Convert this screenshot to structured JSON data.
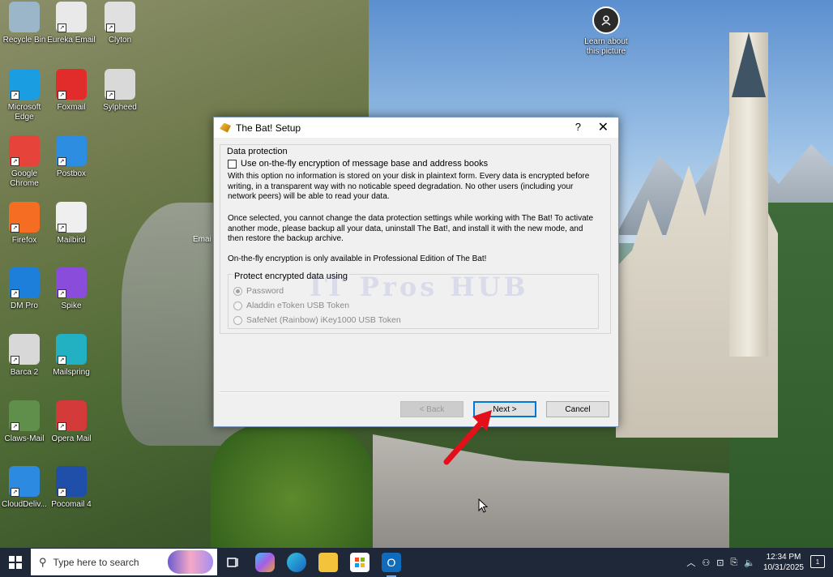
{
  "desktop": {
    "icons": [
      {
        "label": "Recycle Bin",
        "icon": "recycle-bin-icon",
        "color": "#9bb6c9"
      },
      {
        "label": "Eureka Email",
        "icon": "eureka-email-icon",
        "color": "#e9e9e9"
      },
      {
        "label": "Clyton",
        "icon": "clyton-icon",
        "color": "#e0e0e0"
      },
      {
        "label": "Microsoft Edge",
        "icon": "edge-icon",
        "color": "#1b9de2"
      },
      {
        "label": "Foxmail",
        "icon": "foxmail-icon",
        "color": "#e22b2b"
      },
      {
        "label": "Sylpheed",
        "icon": "sylpheed-icon",
        "color": "#d9d9d9"
      },
      {
        "label": "Google Chrome",
        "icon": "chrome-icon",
        "color": "#e6433a"
      },
      {
        "label": "Postbox",
        "icon": "postbox-icon",
        "color": "#2d8de0"
      },
      {
        "label": "Firefox",
        "icon": "firefox-icon",
        "color": "#f46d22"
      },
      {
        "label": "Mailbird",
        "icon": "mailbird-icon",
        "color": "#efefef"
      },
      {
        "label": "DM Pro",
        "icon": "dm-pro-icon",
        "color": "#1d7fd9"
      },
      {
        "label": "Spike",
        "icon": "spike-icon",
        "color": "#8a4ddb"
      },
      {
        "label": "Barca 2",
        "icon": "barca-icon",
        "color": "#d8d8d8"
      },
      {
        "label": "Mailspring",
        "icon": "mailspring-icon",
        "color": "#22b1c2"
      },
      {
        "label": "Claws-Mail",
        "icon": "claws-mail-icon",
        "color": "#5f8f4a"
      },
      {
        "label": "Opera Mail",
        "icon": "opera-mail-icon",
        "color": "#d53a3a"
      },
      {
        "label": "CloudDeliv...",
        "icon": "cloud-delivery-icon",
        "color": "#2c8ae0"
      },
      {
        "label": "Pocomail 4",
        "icon": "pocomail-icon",
        "color": "#1f4fa8"
      }
    ],
    "learn_about": "Learn about this picture",
    "partial_label": "Emai"
  },
  "dialog": {
    "title": "The Bat! Setup",
    "help": "?",
    "close": "✕",
    "group_label": "Data protection",
    "checkbox_label": "Use on-the-fly encryption of message base and address books",
    "para1": "With this option no information is stored on your disk in plaintext form. Every data is encrypted before writing, in a transparent way with no noticable speed degradation. No other users (including your network peers) will be able to read your data.",
    "para2": "Once selected, you cannot change the data protection settings while working with The Bat! To activate another mode, please backup all your data, uninstall The Bat!, and install it with the new mode, and then restore the backup archive.",
    "para3": "On-the-fly encryption is only available in Professional  Edition of The Bat!",
    "protect_label": "Protect encrypted data using",
    "options": [
      "Password",
      "Aladdin eToken USB Token",
      "SafeNet (Rainbow) iKey1000 USB Token"
    ],
    "watermark": "IT Pros HUB",
    "back": "<  Back",
    "next": "Next >",
    "cancel": "Cancel"
  },
  "taskbar": {
    "search_placeholder": "Type here to search",
    "time": "12:34 PM",
    "date": "10/31/2025",
    "notification_count": "1"
  }
}
